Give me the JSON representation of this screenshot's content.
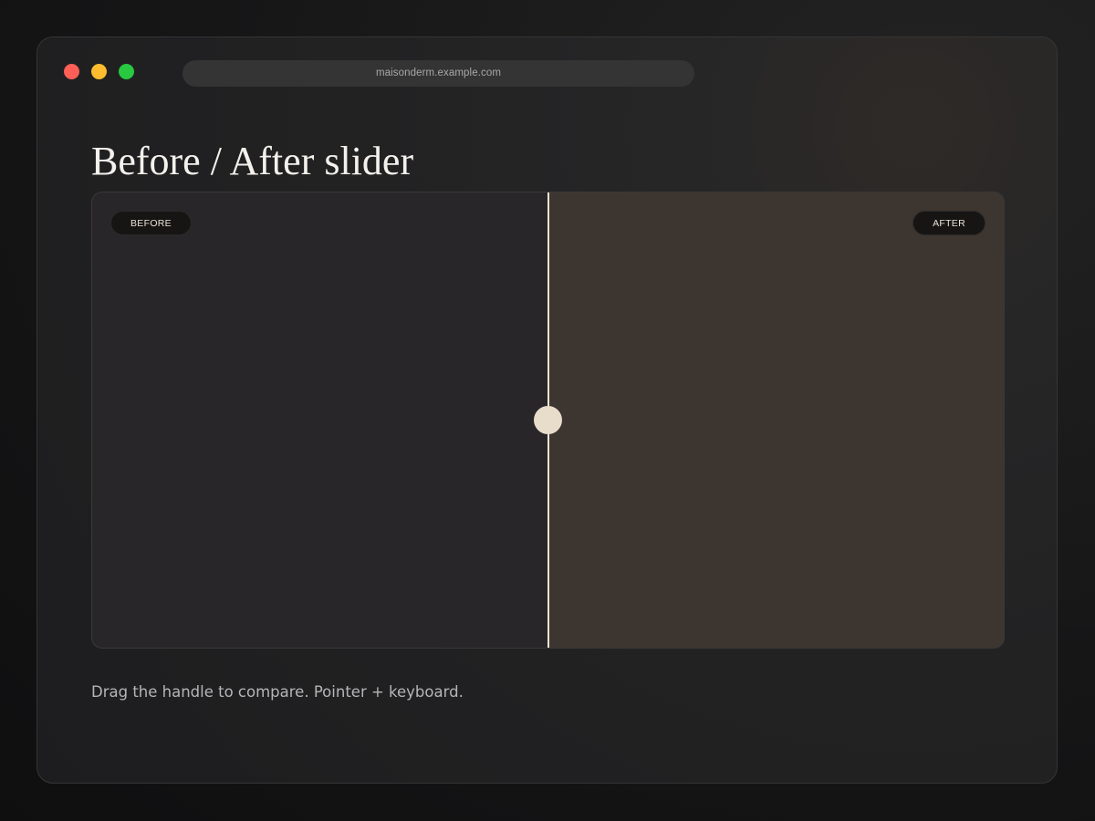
{
  "browser": {
    "url": "maisonderm.example.com",
    "traffic_lights": {
      "close_color": "#ff5f57",
      "minimize_color": "#febc2e",
      "maximize_color": "#28c840"
    }
  },
  "page": {
    "title": "Before / After slider",
    "caption": "Drag the handle to compare. Pointer + keyboard."
  },
  "slider": {
    "before_label": "BEFORE",
    "after_label": "AFTER",
    "position_percent": 50,
    "before_color": "#29262a",
    "after_color": "#3c3530",
    "handle_color": "#e8dccb"
  }
}
